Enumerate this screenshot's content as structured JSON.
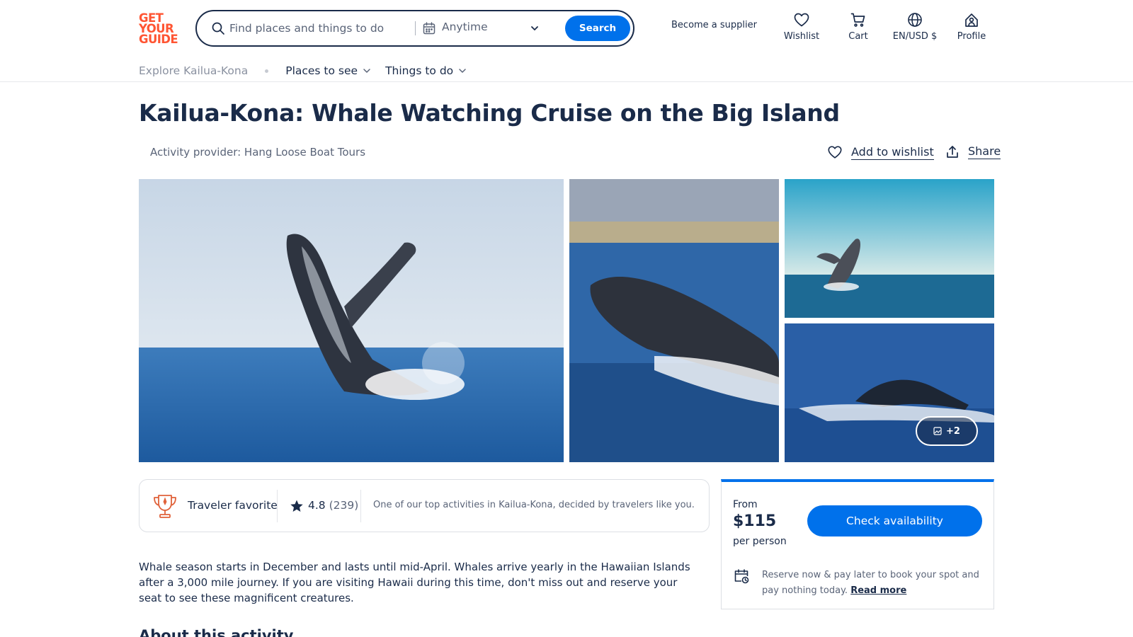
{
  "header": {
    "logo_lines": [
      "GET",
      "YOUR",
      "GUIDE"
    ],
    "search": {
      "placeholder": "Find places and things to do",
      "date_label": "Anytime",
      "button_label": "Search"
    },
    "supplier_link": "Become a supplier",
    "actions": {
      "wishlist": "Wishlist",
      "cart": "Cart",
      "locale": "EN/USD $",
      "profile": "Profile"
    },
    "icons": [
      "search-icon",
      "calendar-icon",
      "chevron-down-icon",
      "heart-icon",
      "cart-icon",
      "globe-icon",
      "profile-icon"
    ]
  },
  "subnav": {
    "explore": "Explore Kailua-Kona",
    "places": "Places to see",
    "things": "Things to do"
  },
  "activity": {
    "title": "Kailua-Kona: Whale Watching Cruise on the Big Island",
    "provider": "Activity provider: Hang Loose Boat Tours",
    "add_to_wishlist": "Add to wishlist",
    "share": "Share"
  },
  "gallery": {
    "more_count": "+2"
  },
  "badges": {
    "traveler_favorite": "Traveler favorite",
    "rating": "4.8",
    "review_count": "(239)",
    "top_note": "One of our top activities in Kailua-Kona, decided by travelers like you."
  },
  "description": "Whale season starts in December and lasts until mid-April. Whales arrive yearly in the Hawaiian Islands after a 3,000 mile journey. If you are visiting Hawaii during this time, don't miss out and reserve your seat to see these magnificent creatures.",
  "about_heading": "About this activity",
  "booking": {
    "from_label": "From",
    "price": "$115",
    "per_person": "per person",
    "check_button": "Check availability",
    "reserve_text": "Reserve now & pay later to book your spot and pay nothing today.",
    "read_more": "Read more"
  },
  "colors": {
    "brand": "#ff5533",
    "primary_blue": "#0071eb",
    "text_dark": "#1a2b49"
  }
}
